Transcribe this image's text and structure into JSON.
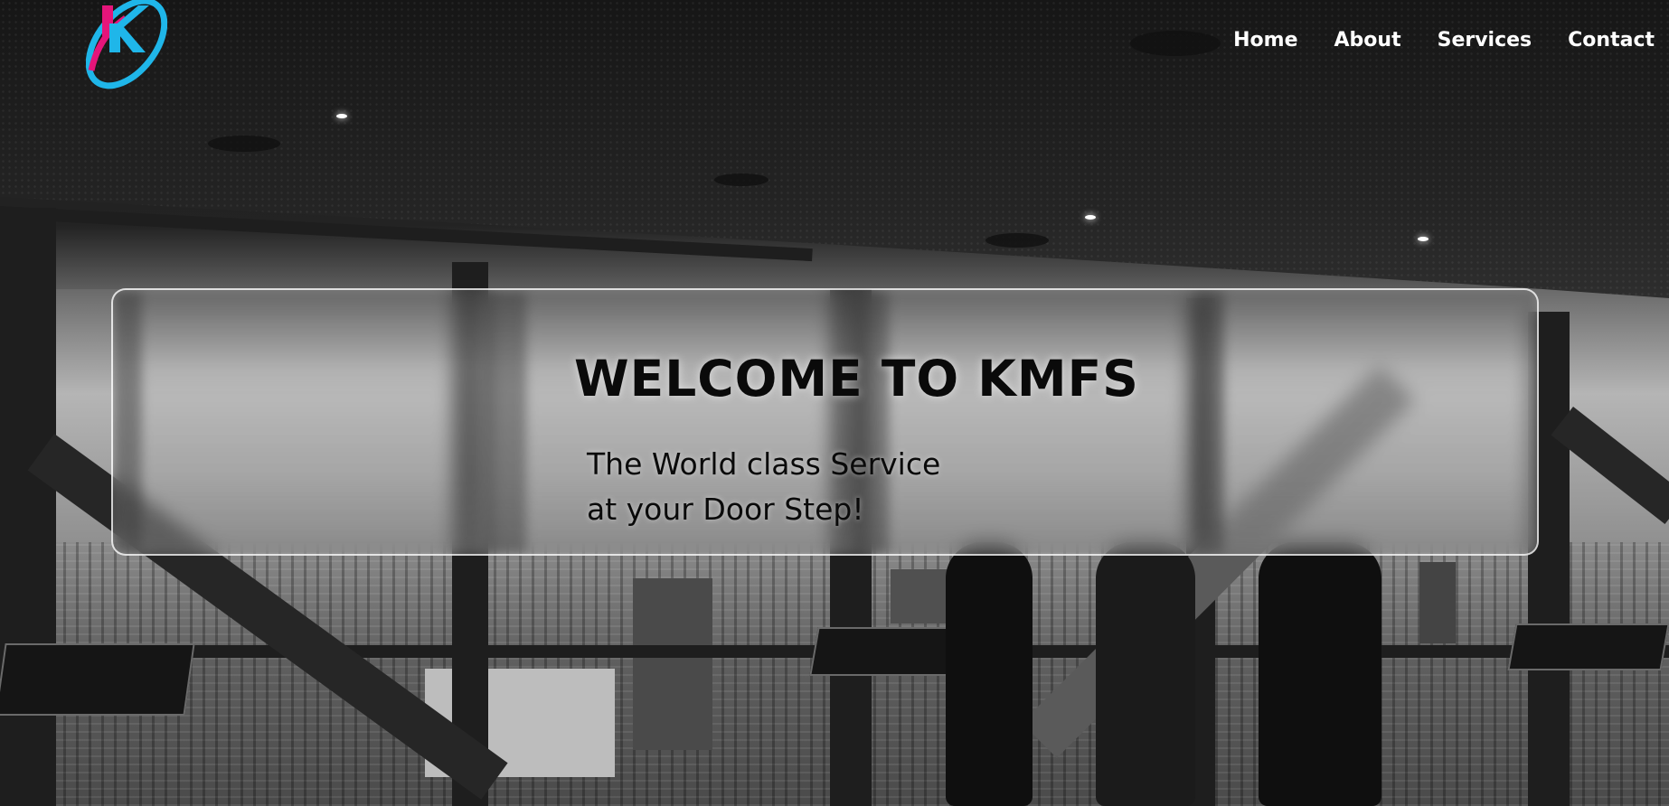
{
  "nav": {
    "items": [
      {
        "label": "Home"
      },
      {
        "label": "About"
      },
      {
        "label": "Services"
      },
      {
        "label": "Contact"
      }
    ]
  },
  "hero": {
    "title": "WELCOME TO KMFS",
    "subtitle_line1": "The World class Service",
    "subtitle_line2": "at your Door Step!"
  },
  "colors": {
    "logo_magenta": "#e5157a",
    "logo_cyan": "#1fb6e9",
    "nav_text": "#ffffff",
    "hero_text": "#0a0a0a"
  },
  "icons": {
    "logo": "kmfs-k-logo-icon"
  }
}
